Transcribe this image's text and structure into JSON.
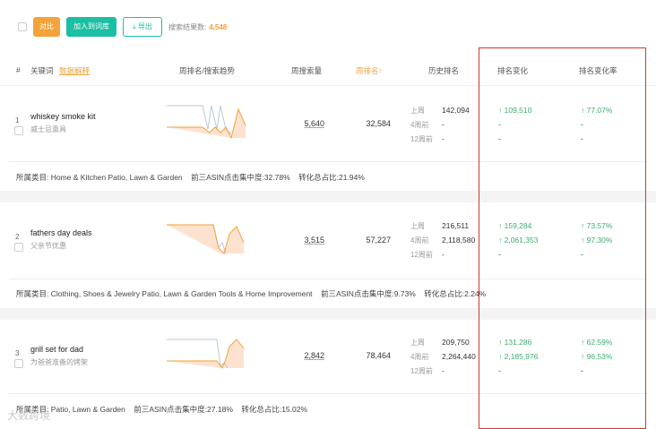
{
  "toolbar": {
    "compare_label": "对比",
    "add_to_library_label": "加入到词库",
    "export_label": "导出",
    "result_label": "搜索结果数:",
    "result_count": "4,548"
  },
  "header": {
    "col_index": "#",
    "col_keyword": "关键词",
    "col_data_explain": "数据解释",
    "col_weekly_rank_trend": "周排名/搜索趋势",
    "col_weekly_search": "周搜索量",
    "col_weekly_rank": "周排名↑",
    "col_history_rank": "历史排名",
    "col_rank_change": "排名变化",
    "col_rank_change_rate": "排名变化率"
  },
  "history_labels": [
    "上周",
    "4周前",
    "12周前"
  ],
  "category_prefix": "所属类目: ",
  "rows": [
    {
      "index": "1",
      "keyword": "whiskey smoke kit",
      "keyword_cn": "威士忌熏具",
      "weekly_search": "5,640",
      "weekly_rank": "32,584",
      "history": [
        "142,094",
        "-",
        "-"
      ],
      "rank_change": [
        "↑ 109,510",
        "-",
        "-"
      ],
      "rank_change_rate": [
        "↑ 77.07%",
        "-",
        "-"
      ],
      "category": "所属类目: Home & Kitchen Patio, Lawn & Garden",
      "top3_click": "前三ASIN点击集中度:32.78%",
      "conversion": "转化总占比:21.94%"
    },
    {
      "index": "2",
      "keyword": "fathers day deals",
      "keyword_cn": "父亲节优惠",
      "weekly_search": "3,515",
      "weekly_rank": "57,227",
      "history": [
        "216,511",
        "2,118,580",
        "-"
      ],
      "rank_change": [
        "↑ 159,284",
        "↑ 2,061,353",
        "-"
      ],
      "rank_change_rate": [
        "↑ 73.57%",
        "↑ 97.30%",
        "-"
      ],
      "category": "所属类目: Clothing, Shoes & Jewelry Patio, Lawn & Garden Tools & Home Improvement",
      "top3_click": "前三ASIN点击集中度:9.73%",
      "conversion": "转化总占比:2.24%"
    },
    {
      "index": "3",
      "keyword": "grill set for dad",
      "keyword_cn": "为爸爸准备的烤架",
      "weekly_search": "2,842",
      "weekly_rank": "78,464",
      "history": [
        "209,750",
        "2,264,440",
        "-"
      ],
      "rank_change": [
        "↑ 131,286",
        "↑ 2,185,976",
        "-"
      ],
      "rank_change_rate": [
        "↑ 62.59%",
        "↑ 96.53%",
        "-"
      ],
      "category": "所属类目: Patio, Lawn & Garden",
      "top3_click": "前三ASIN点击集中度:27.18%",
      "conversion": "转化总占比:15.02%"
    }
  ],
  "watermark": "大数跨境",
  "colors": {
    "accent_orange": "#f2a33a",
    "accent_teal": "#1bbfa3",
    "positive_green": "#3cae6e",
    "highlight_red": "#d9342b"
  }
}
